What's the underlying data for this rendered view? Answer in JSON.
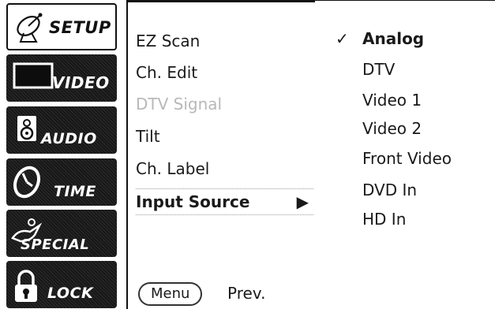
{
  "sidebar": {
    "items": [
      {
        "label": "SETUP",
        "icon": "satellite-dish-icon",
        "active": true
      },
      {
        "label": "VIDEO",
        "icon": "tv-screen-icon",
        "active": false
      },
      {
        "label": "AUDIO",
        "icon": "speaker-icon",
        "active": false
      },
      {
        "label": "TIME",
        "icon": "clock-icon",
        "active": false
      },
      {
        "label": "SPECIAL",
        "icon": "magic-lamp-icon",
        "active": false
      },
      {
        "label": "LOCK",
        "icon": "padlock-icon",
        "active": false
      }
    ]
  },
  "submenu": {
    "items": [
      {
        "label": "EZ Scan",
        "state": "normal"
      },
      {
        "label": "Ch. Edit",
        "state": "normal"
      },
      {
        "label": "DTV Signal",
        "state": "disabled"
      },
      {
        "label": "Tilt",
        "state": "normal"
      },
      {
        "label": "Ch. Label",
        "state": "normal"
      },
      {
        "label": "Input Source",
        "state": "selected",
        "arrow": "▶"
      }
    ],
    "menu_button": "Menu",
    "prev_label": "Prev."
  },
  "options": {
    "check_mark": "✓",
    "items": [
      "Analog",
      "DTV",
      "Video 1",
      "Video 2",
      "Front Video",
      "DVD In",
      "HD In"
    ],
    "selected": "Analog"
  },
  "colors": {
    "panel_dark": "#171717",
    "disabled_text": "#b8b8b8",
    "text": "#1a1a1a"
  }
}
